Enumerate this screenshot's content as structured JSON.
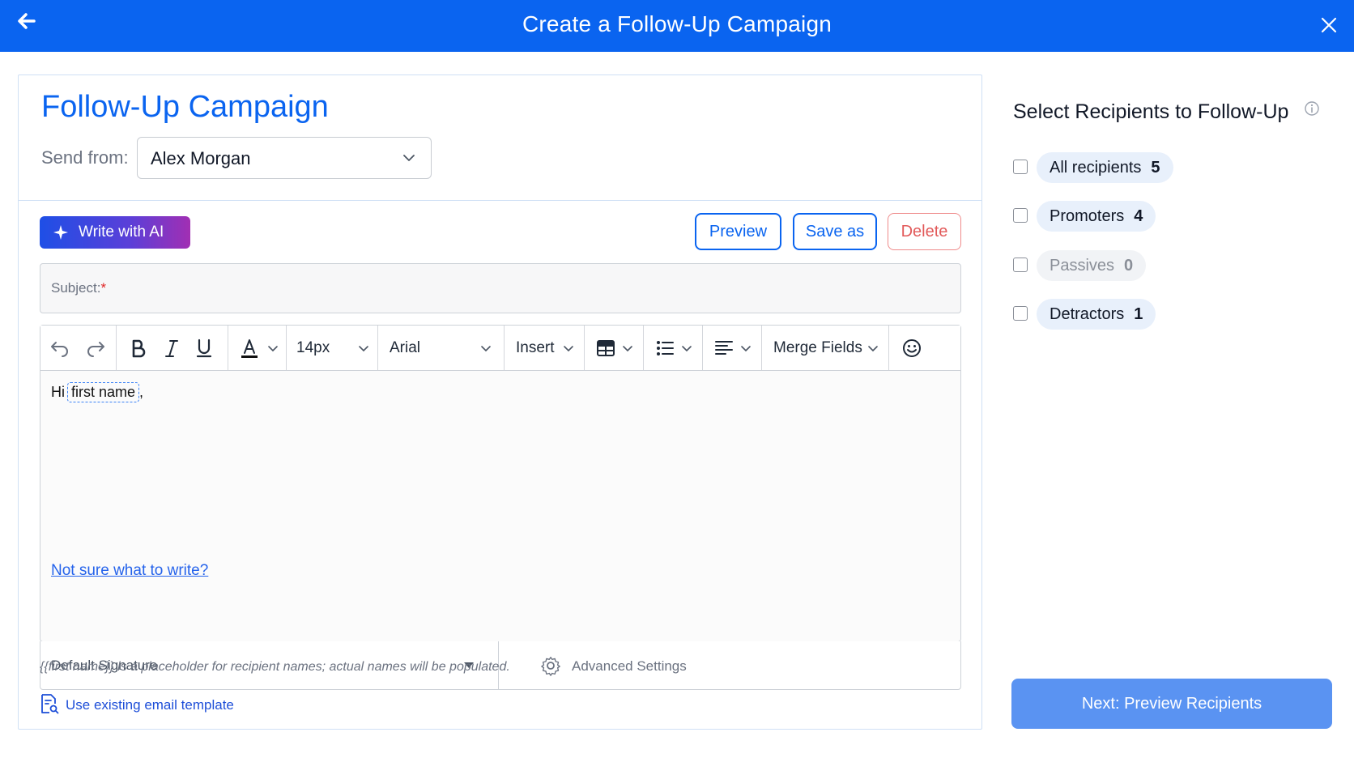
{
  "header": {
    "title": "Create a Follow-Up Campaign",
    "color": "#0a64f0"
  },
  "campaign": {
    "title": "Follow-Up Campaign",
    "send_from_label": "Send from:",
    "sender": "Alex Morgan"
  },
  "actions": {
    "write_with_ai": "Write with AI",
    "preview": "Preview",
    "save_as": "Save as",
    "delete": "Delete"
  },
  "subject": {
    "label": "Subject:",
    "required_mark": "*"
  },
  "toolbar": {
    "font_size": "14px",
    "font_family": "Arial",
    "insert": "Insert",
    "merge_fields": "Merge Fields"
  },
  "editor": {
    "greeting": "Hi",
    "merge_tag": "first name",
    "trailing": ",",
    "help_link": "Not sure what to write?"
  },
  "footer": {
    "signature": "Default Signature",
    "advanced_settings": "Advanced Settings",
    "note": "{{first name}} is a placeholder for recipient names; actual names will be populated.",
    "template_link": "Use existing email template"
  },
  "recipients": {
    "title": "Select Recipients to Follow-Up",
    "groups": [
      {
        "label": "All recipients",
        "count": "5"
      },
      {
        "label": "Promoters",
        "count": "4"
      },
      {
        "label": "Passives",
        "count": "0"
      },
      {
        "label": "Detractors",
        "count": "1"
      }
    ],
    "next_button": "Next: Preview Recipients"
  }
}
